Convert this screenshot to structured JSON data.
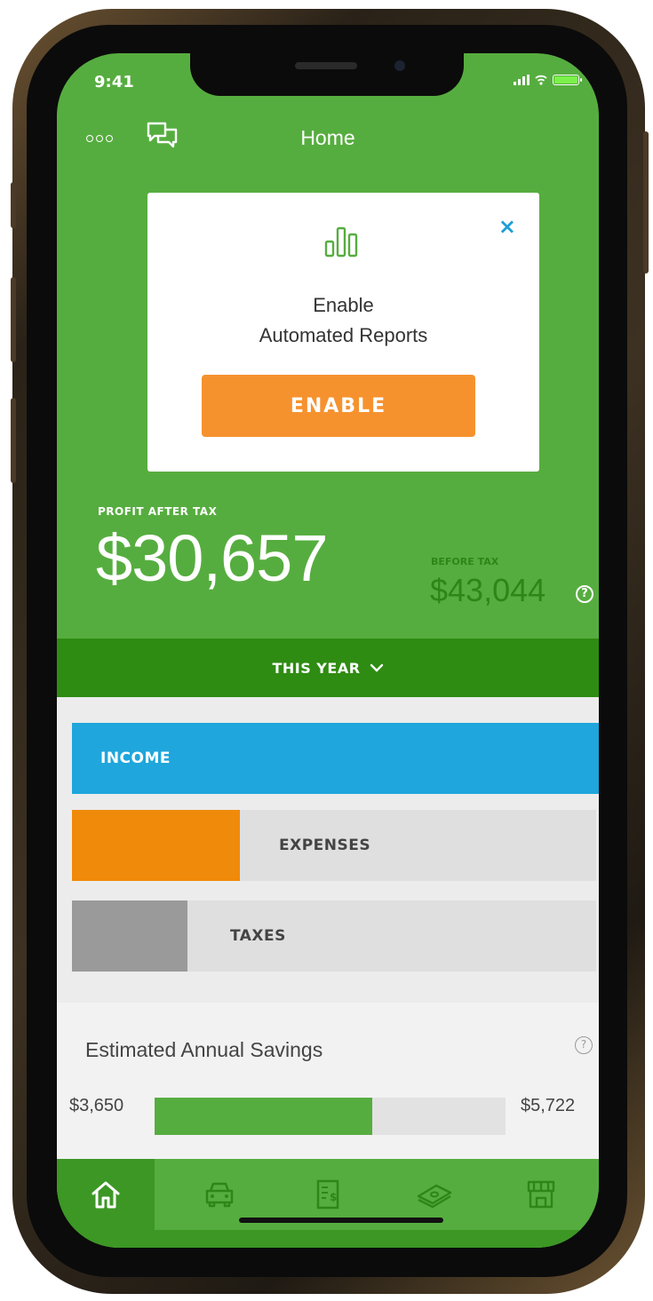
{
  "status_bar": {
    "time": "9:41"
  },
  "header": {
    "title": "Home"
  },
  "promo": {
    "title_line1": "Enable",
    "title_line2": "Automated Reports",
    "button_label": "ENABLE",
    "close_symbol": "×"
  },
  "profit": {
    "label": "PROFIT AFTER TAX",
    "value": "$30,657",
    "before_tax_label": "BEFORE TAX",
    "before_tax_value": "$43,044",
    "help_symbol": "?"
  },
  "period": {
    "label": "THIS YEAR"
  },
  "breakdown": [
    {
      "label": "INCOME",
      "fill_fraction": 1.0,
      "color": "#1fa6dc"
    },
    {
      "label": "EXPENSES",
      "fill_fraction": 0.32,
      "color": "#f08a0a"
    },
    {
      "label": "TAXES",
      "fill_fraction": 0.22,
      "color": "#9a9a9a"
    }
  ],
  "savings": {
    "title": "Estimated Annual Savings",
    "min_label": "$3,650",
    "max_label": "$5,722",
    "fill_fraction": 0.62,
    "help_symbol": "?"
  },
  "tabs": [
    {
      "name": "home",
      "icon": "home-icon",
      "active": true
    },
    {
      "name": "trips",
      "icon": "car-icon",
      "active": false
    },
    {
      "name": "receipts",
      "icon": "receipt-icon",
      "active": false
    },
    {
      "name": "money",
      "icon": "money-icon",
      "active": false
    },
    {
      "name": "store",
      "icon": "storefront-icon",
      "active": false
    }
  ],
  "colors": {
    "brand_green": "#56ad3f",
    "dark_green": "#2e8c12",
    "accent_orange": "#f6922e",
    "income_blue": "#1fa6dc"
  }
}
